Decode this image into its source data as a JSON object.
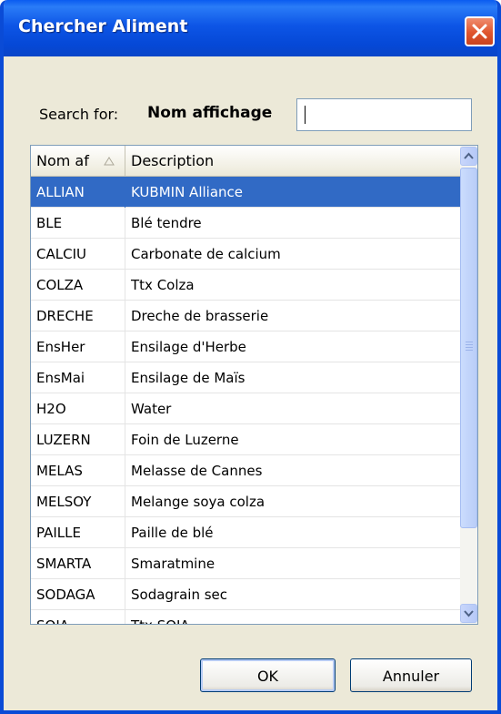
{
  "window": {
    "title": "Chercher Aliment"
  },
  "search": {
    "label": "Search for:",
    "field_name": "Nom affichage",
    "value": ""
  },
  "grid": {
    "columns": [
      "Nom af",
      "Description"
    ],
    "rows": [
      {
        "code": "ALLIAN",
        "description": "KUBMIN Alliance",
        "selected": true
      },
      {
        "code": "BLE",
        "description": "Blé tendre"
      },
      {
        "code": "CALCIU",
        "description": "Carbonate de calcium"
      },
      {
        "code": "COLZA",
        "description": "Ttx Colza"
      },
      {
        "code": "DRECHE",
        "description": "Dreche de brasserie"
      },
      {
        "code": "EnsHer",
        "description": "Ensilage d'Herbe"
      },
      {
        "code": "EnsMai",
        "description": "Ensilage de Maïs"
      },
      {
        "code": "H2O",
        "description": "Water"
      },
      {
        "code": "LUZERN",
        "description": "Foin de Luzerne"
      },
      {
        "code": "MELAS",
        "description": "Melasse de Cannes"
      },
      {
        "code": "MELSOY",
        "description": "Melange soya colza"
      },
      {
        "code": "PAILLE",
        "description": "Paille de blé"
      },
      {
        "code": "SMARTA",
        "description": "Smaratmine"
      },
      {
        "code": "SODAGA",
        "description": "Sodagrain sec"
      },
      {
        "code": "SOJA",
        "description": "Ttx SOJA"
      }
    ]
  },
  "buttons": {
    "ok": "OK",
    "cancel": "Annuler"
  },
  "colors": {
    "titlebar": "#0a55e6",
    "selection": "#316ac5",
    "close": "#e0552e"
  }
}
